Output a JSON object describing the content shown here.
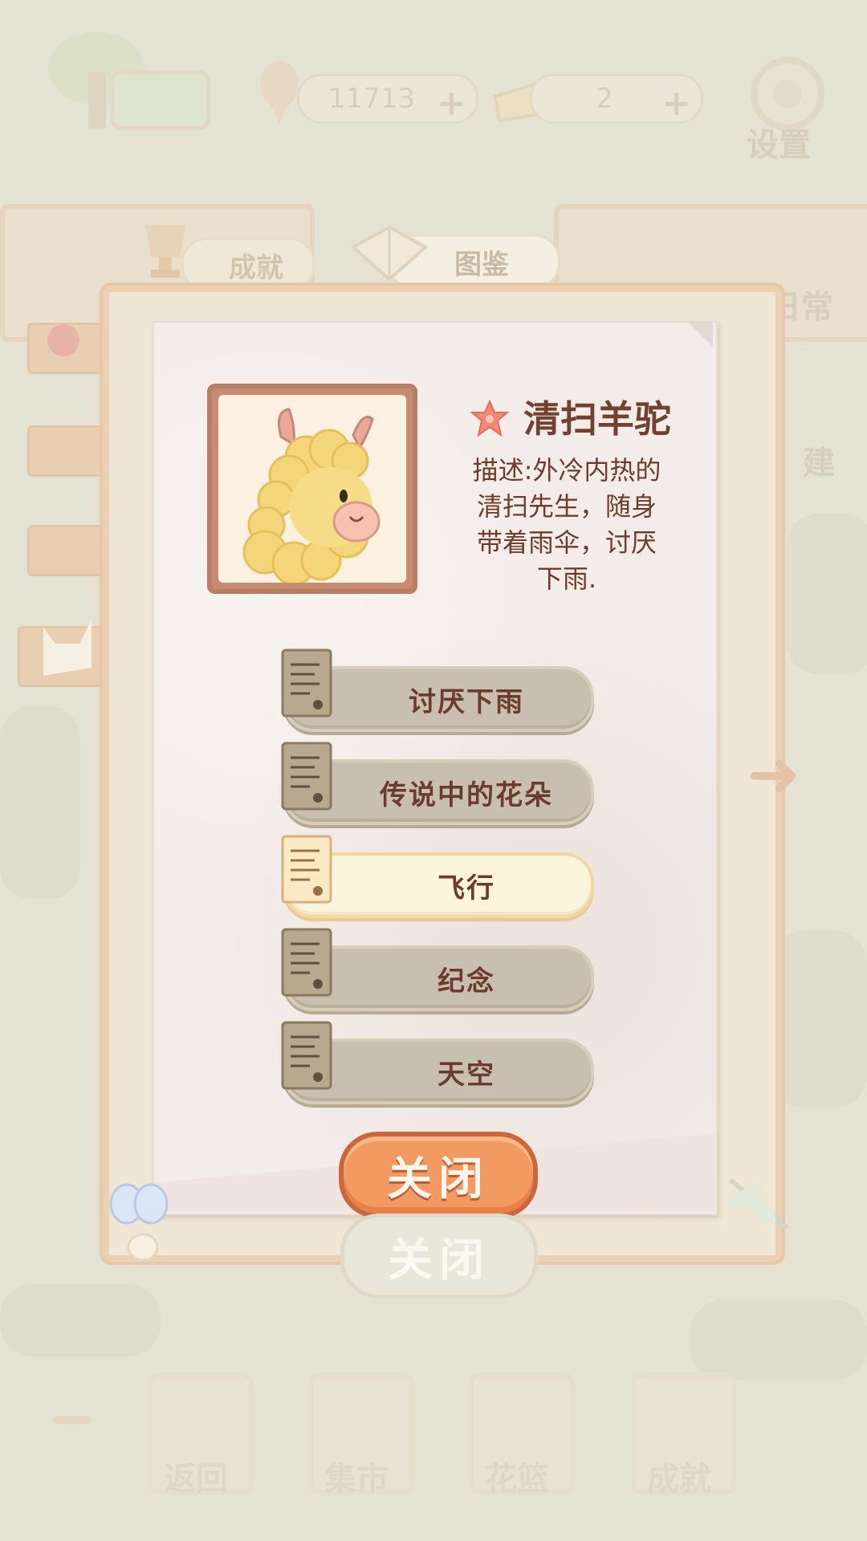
{
  "topbar": {
    "fish_count": "11713",
    "cheese_count": "2",
    "settings_label": "设置"
  },
  "tabs": {
    "achievements": "成就",
    "collection": "图鉴"
  },
  "side_labels": {
    "daily": "日常",
    "build": "建"
  },
  "card": {
    "name": "清扫羊驼",
    "description_lines": [
      "描述:外冷内热的",
      "清扫先生，随身",
      "带着雨伞，讨厌",
      "下雨."
    ],
    "entries": [
      {
        "label": "讨厌下雨",
        "selected": false
      },
      {
        "label": "传说中的花朵",
        "selected": false
      },
      {
        "label": "飞行",
        "selected": true
      },
      {
        "label": "纪念",
        "selected": false
      },
      {
        "label": "天空",
        "selected": false
      }
    ],
    "close_label": "关闭"
  },
  "ghost_close_label": "关闭",
  "bottom_nav": {
    "back": "返回",
    "market": "集市",
    "flower_basket": "花篮",
    "achievements": "成就"
  },
  "colors": {
    "accent_orange": "#f29a61",
    "title_brown": "#74402f",
    "entry_idle": "#c8bfae",
    "entry_selected": "#fdf4dc"
  }
}
